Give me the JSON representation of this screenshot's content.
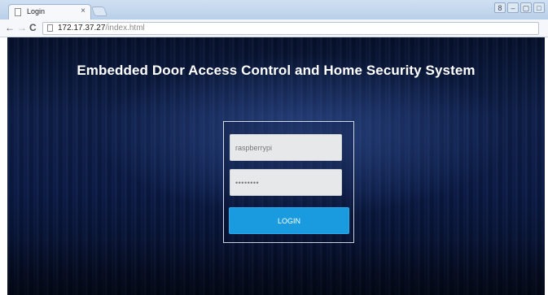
{
  "browser": {
    "tab_title": "Login",
    "tab_close": "×",
    "url_host": "172.17.37.27",
    "url_path": "/index.html",
    "window_controls": [
      "8",
      "–",
      "▢",
      "□"
    ]
  },
  "page": {
    "heading": "Embedded Door Access Control and Home Security System",
    "login": {
      "username_value": "raspberrypi",
      "password_value": "••••••••",
      "button_label": "LOGIN"
    }
  },
  "colors": {
    "background": "#0b1a44",
    "button": "#1a9be0",
    "field": "#e7e8ea"
  }
}
